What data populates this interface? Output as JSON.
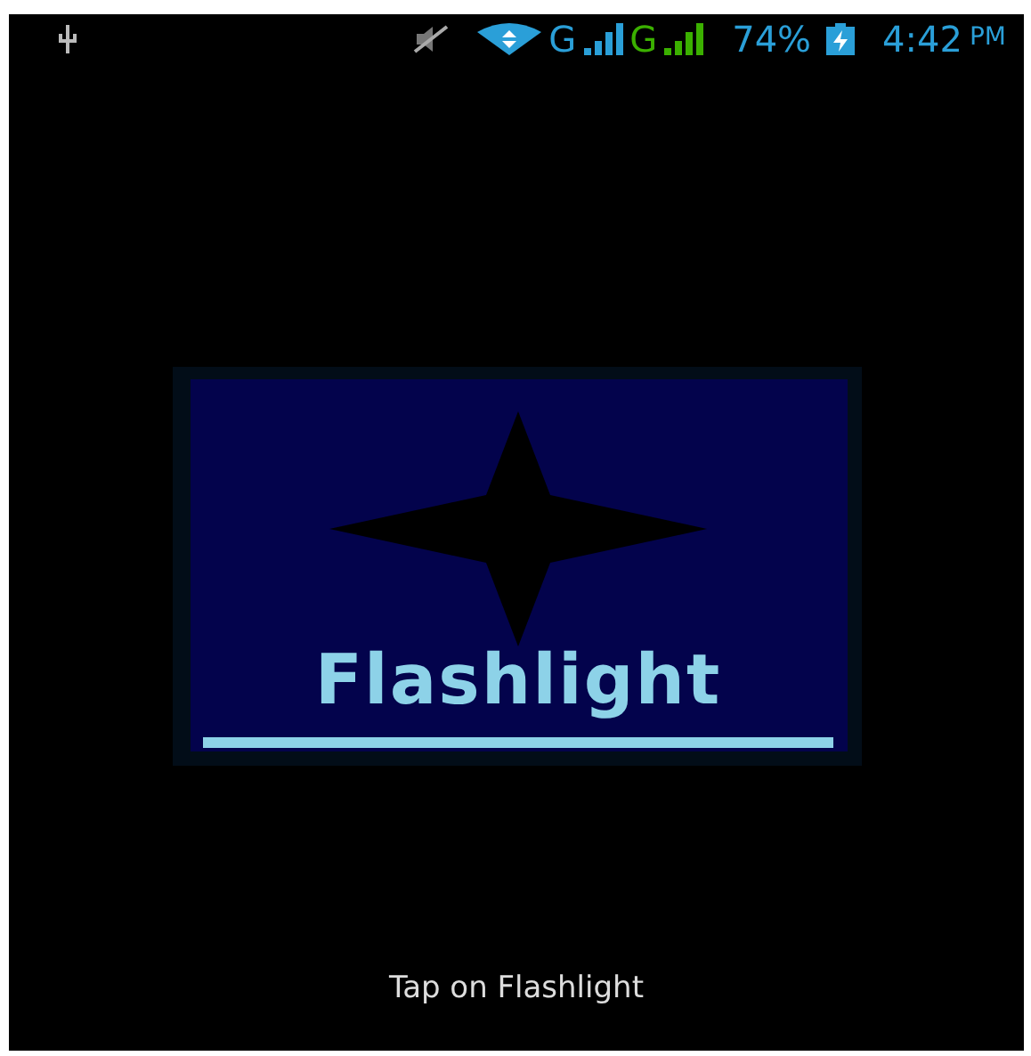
{
  "status_bar": {
    "network_1": "G",
    "network_2": "G",
    "battery": "74%",
    "time": "4:42",
    "meridiem": "PM"
  },
  "widget": {
    "title": "Flashlight"
  },
  "hint": "Tap on Flashlight"
}
